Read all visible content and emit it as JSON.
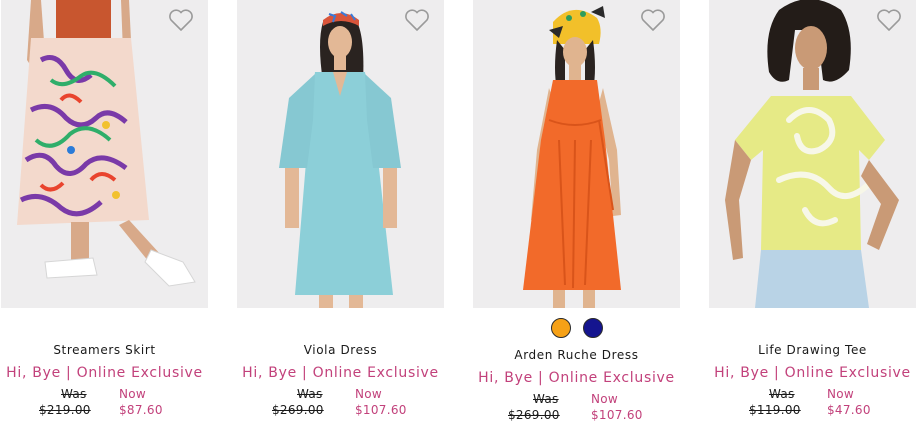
{
  "products": [
    {
      "name": "Streamers Skirt",
      "promo": "Hi, Bye | Online Exclusive",
      "was_label": "Was",
      "was_price": "$219.00",
      "now_label": "Now",
      "now_price": "$87.60",
      "wishlist_icon": "heart-outline-icon",
      "garment_color": "#f3d9cc"
    },
    {
      "name": "Viola Dress",
      "promo": "Hi, Bye | Online Exclusive",
      "was_label": "Was",
      "was_price": "$269.00",
      "now_label": "Now",
      "now_price": "$107.60",
      "wishlist_icon": "heart-outline-icon",
      "garment_color": "#8ccfd8"
    },
    {
      "name": "Arden Ruche Dress",
      "promo": "Hi, Bye | Online Exclusive",
      "was_label": "Was",
      "was_price": "$269.00",
      "now_label": "Now",
      "now_price": "$107.60",
      "wishlist_icon": "heart-outline-icon",
      "garment_color": "#f26a2a",
      "swatches": [
        {
          "name": "orange",
          "color": "#f6a116"
        },
        {
          "name": "navy",
          "color": "#14148f"
        }
      ]
    },
    {
      "name": "Life Drawing Tee",
      "promo": "Hi, Bye | Online Exclusive",
      "was_label": "Was",
      "was_price": "$119.00",
      "now_label": "Now",
      "now_price": "$47.60",
      "wishlist_icon": "heart-outline-icon",
      "garment_color": "#e6ea86"
    }
  ],
  "colors": {
    "accent": "#c2417b",
    "image_bg": "#eeedee",
    "text": "#1a1a1a"
  }
}
